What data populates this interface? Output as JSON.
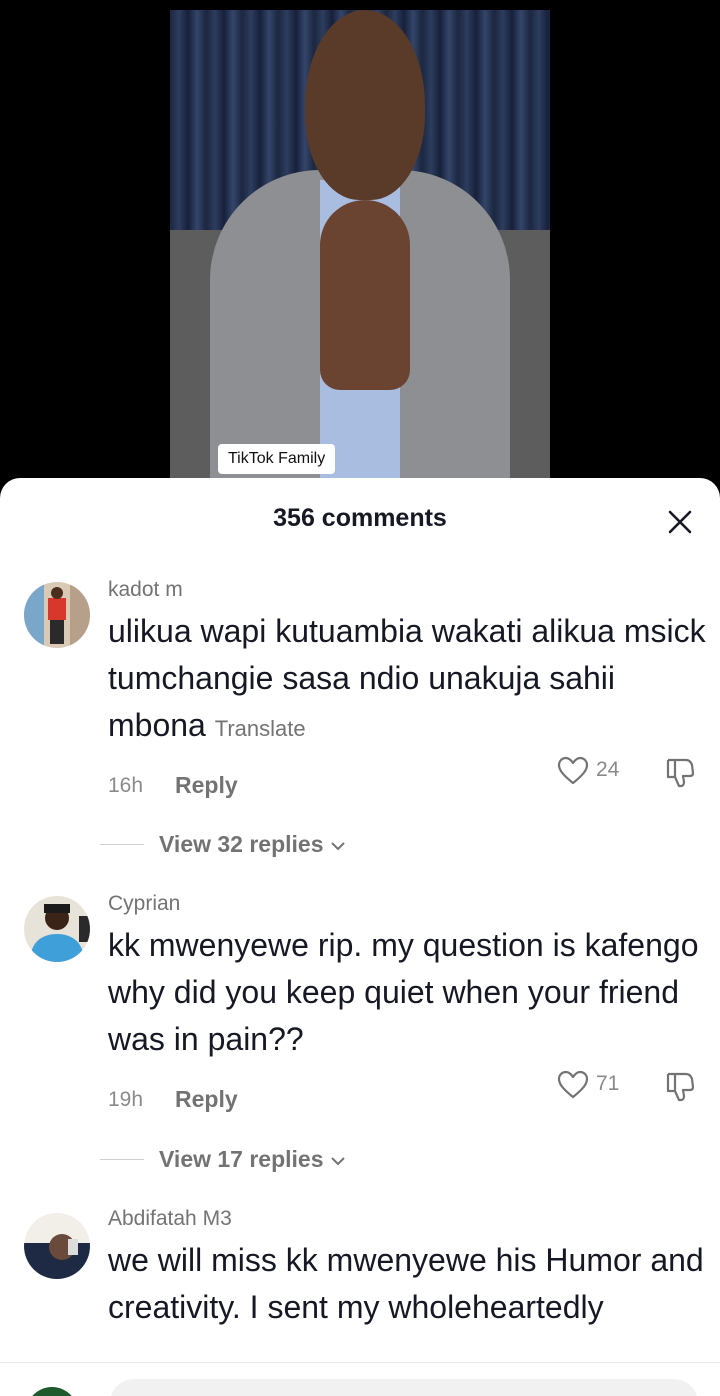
{
  "video": {
    "caption_badge": "TikTok Family"
  },
  "sheet": {
    "title": "356 comments"
  },
  "comments": [
    {
      "username": "kadot m",
      "text": "ulikua wapi kutuambia wakati alikua msick tumchangie sasa ndio unakuja sahii mbona",
      "translate_label": "Translate",
      "time": "16h",
      "reply_label": "Reply",
      "likes": "24",
      "view_replies": "View 32 replies"
    },
    {
      "username": "Cyprian",
      "text": "kk mwenyewe rip. my question is kafengo why did you keep quiet when your friend was in pain??",
      "time": "19h",
      "reply_label": "Reply",
      "likes": "71",
      "view_replies": "View 17 replies"
    },
    {
      "username": "Abdifatah M3",
      "text": "we will miss kk mwenyewe his Humor and creativity. I sent my wholeheartedly"
    }
  ],
  "icons": {
    "close": "close-icon",
    "like": "heart-icon",
    "dislike": "thumbs-down-icon",
    "expand": "chevron-down-icon"
  },
  "colors": {
    "primary_text": "#161823",
    "secondary_text": "#737373",
    "sheet_bg": "#ffffff"
  }
}
